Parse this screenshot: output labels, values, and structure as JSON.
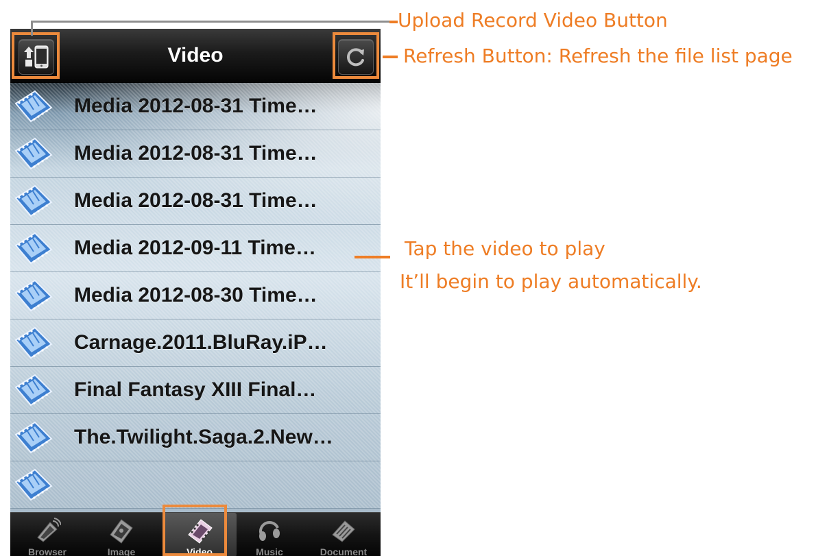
{
  "navbar": {
    "title": "Video",
    "upload_icon": "upload-record-video-icon",
    "refresh_icon": "refresh-icon"
  },
  "files": [
    {
      "name": "Media 2012-08-31 Time…",
      "icon": "film-strip-icon"
    },
    {
      "name": "Media 2012-08-31 Time…",
      "icon": "film-strip-icon"
    },
    {
      "name": "Media 2012-08-31 Time…",
      "icon": "film-strip-icon"
    },
    {
      "name": "Media 2012-09-11 Time…",
      "icon": "film-strip-icon"
    },
    {
      "name": "Media 2012-08-30 Time…",
      "icon": "film-strip-icon"
    },
    {
      "name": "Carnage.2011.BluRay.iP…",
      "icon": "film-strip-icon"
    },
    {
      "name": "Final Fantasy XIII Final…",
      "icon": "film-strip-icon"
    },
    {
      "name": "The.Twilight.Saga.2.New…",
      "icon": "film-strip-icon"
    },
    {
      "name": "",
      "icon": "film-strip-icon"
    }
  ],
  "tabbar": {
    "active": "Video",
    "tabs": [
      {
        "label": "Browser",
        "icon": "browser-icon"
      },
      {
        "label": "Image",
        "icon": "image-icon"
      },
      {
        "label": "Video",
        "icon": "video-film-icon"
      },
      {
        "label": "Music",
        "icon": "headphones-icon"
      },
      {
        "label": "Document",
        "icon": "document-icon"
      }
    ]
  },
  "annotations": {
    "upload": "Upload Record Video Button",
    "refresh": "Refresh Button: Refresh the file list page",
    "tap_line1": "Tap the video to play",
    "tap_line2": "It’ll begin to play automatically."
  },
  "colors": {
    "annotation": "#ee7d25",
    "highlight_box": "#ec8a3c",
    "navbar": "#1b1b1b",
    "row_text": "#161616"
  }
}
